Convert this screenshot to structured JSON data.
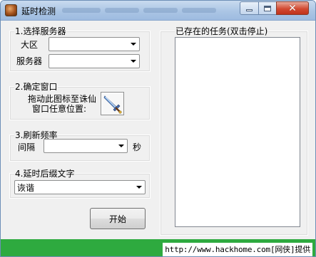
{
  "window": {
    "title": "延时检测",
    "controls": {
      "minimize": "minimize",
      "maximize": "maximize",
      "close": "close"
    }
  },
  "server_group": {
    "label": "1.选择服务器",
    "region_label": "大区",
    "region_value": "",
    "server_label": "服务器",
    "server_value": ""
  },
  "window_group": {
    "label": "2.确定窗口",
    "instruction_line1": "拖动此图标至诛仙",
    "instruction_line2": "窗口任意位置:",
    "drag_icon": "sword-icon"
  },
  "refresh_group": {
    "label": "3.刷新频率",
    "interval_label": "间隔",
    "interval_value": "",
    "unit": "秒"
  },
  "suffix_group": {
    "label": "4.延时后缀文字",
    "suffix_value": "诙谐"
  },
  "start_button": "开始",
  "tasks_group": {
    "label": "已存在的任务(双击停止)",
    "items": []
  },
  "watermark": "http://www.hackhome.com[网侠]提供"
}
